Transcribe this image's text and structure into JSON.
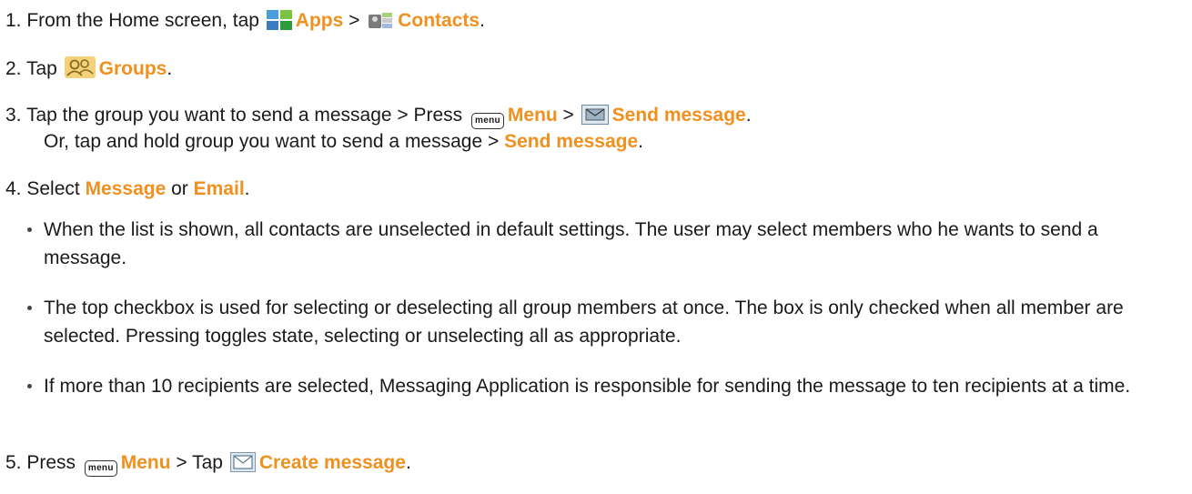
{
  "step1": {
    "prefix": "1. From the Home screen, tap ",
    "apps": "Apps",
    "sep": " > ",
    "contacts": "Contacts",
    "end": "."
  },
  "step2": {
    "prefix": "2. Tap ",
    "groups": "Groups",
    "end": "."
  },
  "step3": {
    "prefix": "3. Tap the group you want to send a message > Press ",
    "menu_key": "menu",
    "menu": "Menu",
    "sep": " > ",
    "send_message": "Send message",
    "end": ".",
    "alt_prefix": "Or, tap and hold group you want to send a message > ",
    "alt_send_message": "Send message",
    "alt_end": "."
  },
  "step4": {
    "prefix": "4. Select ",
    "message": "Message",
    "or": " or ",
    "email": "Email",
    "end": ".",
    "bullets": [
      "When the list is shown, all contacts are unselected in default settings. The user may select members who he wants to send a message.",
      "The top checkbox is used for selecting or deselecting all group members at once. The box is only checked when all member are selected. Pressing toggles state, selecting or unselecting all as appropriate.",
      "If more than 10 recipients are selected, Messaging Application is responsible for sending the message to ten recipients at a time."
    ]
  },
  "step5": {
    "prefix": "5.  Press ",
    "menu_key": "menu",
    "menu": "Menu",
    "sep": " > Tap ",
    "create_message": "Create message",
    "end": "."
  },
  "colors": {
    "highlight": "#f0901e",
    "text": "#1a1a1a"
  },
  "icons": [
    "apps-icon",
    "contacts-icon",
    "groups-icon",
    "send-message-icon",
    "envelope-icon"
  ]
}
